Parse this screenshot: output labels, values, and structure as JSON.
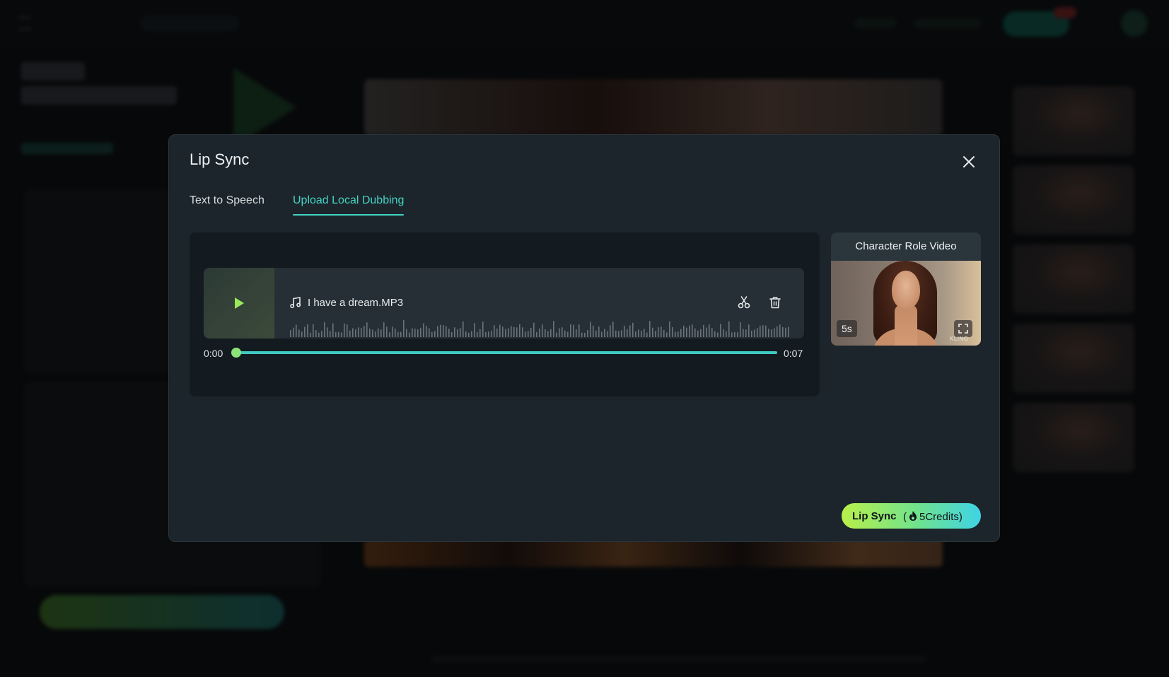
{
  "modal": {
    "title": "Lip Sync",
    "tabs": [
      {
        "label": "Text to Speech",
        "active": false
      },
      {
        "label": "Upload Local Dubbing",
        "active": true
      }
    ],
    "audio": {
      "file_name": "I have a dream.MP3",
      "current_time": "0:00",
      "duration": "0:07",
      "progress": 0.0
    },
    "character": {
      "title": "Character Role Video",
      "duration": "5s",
      "watermark": "KLING"
    },
    "action": {
      "label": "Lip Sync",
      "credits_open": "(",
      "credits_value": "5",
      "credits_unit": "Credits",
      "credits_close": ")"
    },
    "colors": {
      "accent": "#45d3c4",
      "play": "#9bea5a",
      "button_start": "#b8f04a",
      "button_end": "#3fd3e6"
    },
    "icons": {
      "close": "close-icon",
      "play": "play-icon",
      "music": "music-note-icon",
      "cut": "scissors-icon",
      "delete": "trash-icon",
      "expand": "expand-icon",
      "credits": "flame-icon"
    }
  }
}
